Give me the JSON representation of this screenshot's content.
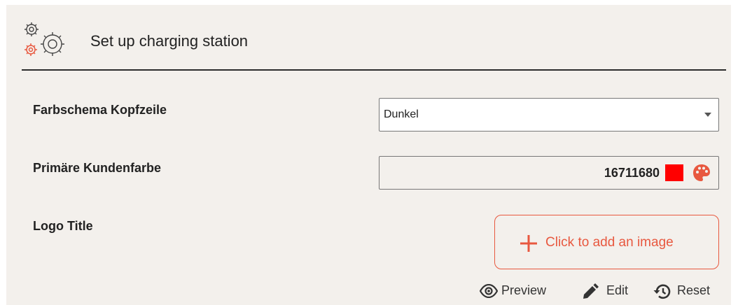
{
  "header": {
    "title": "Set up charging station",
    "icon": "gears-icon"
  },
  "fields": {
    "header_color_scheme": {
      "label": "Farbschema Kopfzeile",
      "value": "Dunkel"
    },
    "primary_color": {
      "label": "Primäre Kundenfarbe",
      "value": "16711680",
      "swatch_color": "#ff0000"
    },
    "logo": {
      "label": "Logo Title",
      "add_image_label": "Click to add an image"
    }
  },
  "actions": {
    "preview_label": "Preview",
    "edit_label": "Edit",
    "reset_label": "Reset"
  },
  "colors": {
    "accent": "#e8583f",
    "panel_background": "#f3f0ec"
  }
}
